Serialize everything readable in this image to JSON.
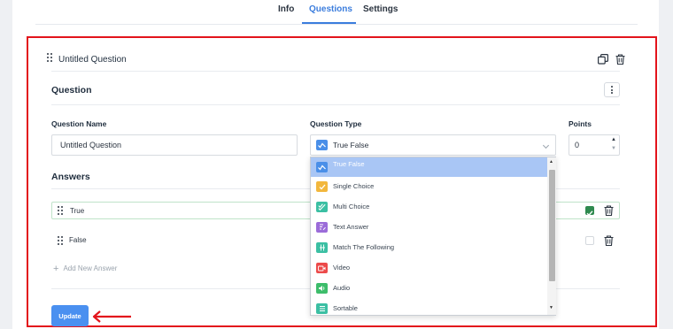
{
  "tabs": [
    {
      "label": "Info",
      "active": false
    },
    {
      "label": "Questions",
      "active": true
    },
    {
      "label": "Settings",
      "active": false
    }
  ],
  "question_header": {
    "title": "Untitled Question"
  },
  "question_section": {
    "title": "Question",
    "name_label": "Question Name",
    "name_value": "Untitled Question",
    "type_label": "Question Type",
    "type_value": "True False",
    "points_label": "Points",
    "points_value": "0"
  },
  "answers_section": {
    "title": "Answers",
    "items": [
      {
        "label": "True",
        "checked": true
      },
      {
        "label": "False",
        "checked": false
      }
    ],
    "add_label": "Add New Answer"
  },
  "update_label": "Update",
  "dropdown": {
    "options": [
      {
        "label": "True False",
        "icon": "true-false-icon",
        "color": "#4a8fe8",
        "selected": true
      },
      {
        "label": "Single Choice",
        "icon": "single-choice-icon",
        "color": "#f2b73d",
        "selected": false
      },
      {
        "label": "Multi Choice",
        "icon": "multi-choice-icon",
        "color": "#3bbfa3",
        "selected": false
      },
      {
        "label": "Text Answer",
        "icon": "text-answer-icon",
        "color": "#9b6cd9",
        "selected": false
      },
      {
        "label": "Match The Following",
        "icon": "match-icon",
        "color": "#3bbfa3",
        "selected": false
      },
      {
        "label": "Video",
        "icon": "video-icon",
        "color": "#ec4a4a",
        "selected": false
      },
      {
        "label": "Audio",
        "icon": "audio-icon",
        "color": "#3dbd6b",
        "selected": false
      },
      {
        "label": "Sortable",
        "icon": "sortable-icon",
        "color": "#3bbfa3",
        "selected": false
      }
    ]
  },
  "colors": {
    "accent": "#3b7ddd",
    "highlight_border": "#e3141c",
    "update_button": "#4a90f0",
    "checked": "#2f8a4f",
    "selected_option": "#a9c6f5"
  }
}
